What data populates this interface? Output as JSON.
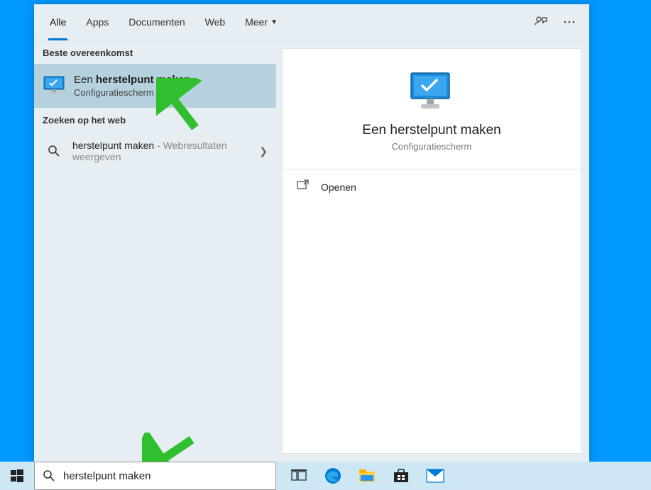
{
  "tabs": {
    "all": "Alle",
    "apps": "Apps",
    "documents": "Documenten",
    "web": "Web",
    "more": "Meer"
  },
  "sections": {
    "best_match": "Beste overeenkomst",
    "web_search": "Zoeken op het web"
  },
  "best_match": {
    "title_prefix": "Een ",
    "title_bold": "herstelpunt maken",
    "subtitle": "Configuratiescherm"
  },
  "web_result": {
    "query": "herstelpunt maken",
    "suffix": " - Webresultaten weergeven"
  },
  "preview": {
    "title": "Een herstelpunt maken",
    "subtitle": "Configuratiescherm",
    "open": "Openen"
  },
  "search": {
    "value": "herstelpunt maken"
  }
}
